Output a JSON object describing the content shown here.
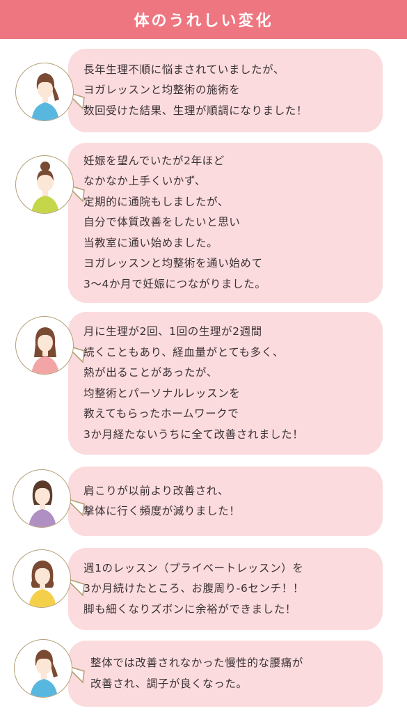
{
  "header": {
    "title": "体のうれしい変化"
  },
  "testimonials": [
    {
      "avatar": "woman-avatar-ponytail-blue",
      "shirt_color": "#58b7de",
      "lines": [
        "長年生理不順に悩まされていましたが、",
        "ヨガレッスンと均整術の施術を",
        "数回受けた結果、生理が順調になりました！"
      ]
    },
    {
      "avatar": "woman-avatar-bun-green",
      "shirt_color": "#c5d64a",
      "lines": [
        "妊娠を望んでいたが2年ほど",
        "なかなか上手くいかず、",
        "定期的に通院もしましたが、",
        "自分で体質改善をしたいと思い",
        "当教室に通い始めました。",
        "ヨガレッスンと均整術を通い始めて",
        "3〜4か月で妊娠につながりました。"
      ]
    },
    {
      "avatar": "woman-avatar-long-hair-pink",
      "shirt_color": "#f3a5a6",
      "lines": [
        "月に生理が2回、1回の生理が2週間",
        "続くこともあり、経血量がとても多く、",
        "熱が出ることがあったが、",
        "均整術とパーソナルレッスンを",
        "教えてもらったホームワークで",
        "3か月経たないうちに全て改善されました！"
      ]
    },
    {
      "avatar": "woman-avatar-bob-purple",
      "shirt_color": "#b08fc3",
      "lines": [
        "肩こりが以前より改善され、",
        "撃体に行く頻度が減りました！"
      ]
    },
    {
      "avatar": "woman-avatar-wavy-yellow",
      "shirt_color": "#f4cf4a",
      "lines": [
        "週1のレッスン（プライベートレッスン）を",
        "3か月続けたところ、お腹周り-6センチ！！",
        "脚も細くなりズボンに余裕ができました！"
      ]
    },
    {
      "avatar": "woman-avatar-ponytail-blue",
      "shirt_color": "#58b7de",
      "lines": [
        "整体では改善されなかった慢性的な腰痛が",
        "改善され、調子が良くなった。"
      ]
    }
  ]
}
